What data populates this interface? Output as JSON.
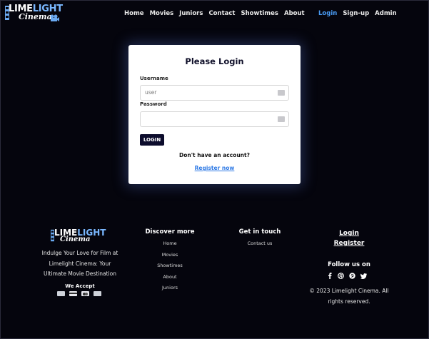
{
  "brand": {
    "logo_text_top_a": "LIME",
    "logo_text_top_b": "LIGHT",
    "logo_text_bottom": "Cinema"
  },
  "nav": {
    "items": [
      "Home",
      "Movies",
      "Juniors",
      "Contact",
      "Showtimes",
      "About"
    ],
    "auth": [
      "Login",
      "Sign-up",
      "Admin"
    ]
  },
  "login_form": {
    "title": "Please Login",
    "username_label": "Username",
    "username_value": "user",
    "password_label": "Password",
    "password_value": "",
    "submit_label": "LOGIN",
    "no_account_text": "Don't have an account?",
    "register_link": "Register now"
  },
  "footer": {
    "tagline": "Indulge Your Love for Film at Limelight Cinema: Your Ultimate Movie Destination",
    "we_accept": "We Accept",
    "payment_icons": [
      "visa-card-icon",
      "credit-card-icon",
      "mastercard-icon",
      "generic-card-icon"
    ],
    "discover_title": "Discover more",
    "discover_items": [
      "Home",
      "Movies",
      "Showtimes",
      "About",
      "Juniors"
    ],
    "contact_title": "Get in touch",
    "contact_items": [
      "Contact us"
    ],
    "login_link": "Login",
    "register_link": "Register",
    "follow_title": "Follow us on",
    "socials": [
      "facebook-icon",
      "dribbble-icon",
      "pinterest-icon",
      "twitter-icon"
    ],
    "copyright": "© 2023 Limelight Cinema. All rights reserved."
  },
  "colors": {
    "background": "#05050d",
    "accent": "#4a9cf5",
    "button": "#0c0c2c",
    "link": "#2f7ae5"
  }
}
